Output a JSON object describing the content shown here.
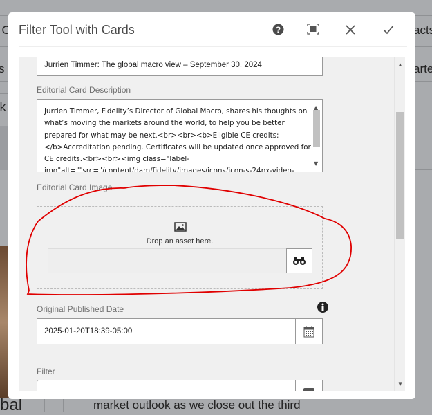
{
  "background": {
    "left_fragments": [
      "l C",
      "s",
      "rk",
      "bal"
    ],
    "right_fragments": [
      "acts",
      "arter"
    ],
    "bottom_text": "market outlook as we close out the third"
  },
  "dialog": {
    "title": "Filter Tool with Cards",
    "icons": [
      "help-icon",
      "fullscreen-icon",
      "close-icon",
      "done-icon"
    ],
    "title_field_value": "Jurrien Timmer: The global macro view – September 30, 2024",
    "description": {
      "label": "Editorial Card Description",
      "value": "Jurrien Timmer, Fidelity’s Director of Global Macro, shares his thoughts on what’s moving the markets around the world, to help you be better prepared for what may be next.<br><br><b>Eligible CE credits: </b>Accreditation pending. Certificates will be updated once approved for CE credits.<br><br><img class=\"label-img\"alt=\"\"src=\"/content/dam/fidelity/images/icons/icon-s-24px-video-"
    },
    "image": {
      "label": "Editorial Card Image",
      "drop_text": "Drop an asset here.",
      "path_value": ""
    },
    "published_date": {
      "label": "Original Published Date",
      "value": "2025-01-20T18:39-05:00"
    },
    "filter": {
      "label": "Filter",
      "value": ""
    },
    "annotation_color": "#e00000"
  }
}
